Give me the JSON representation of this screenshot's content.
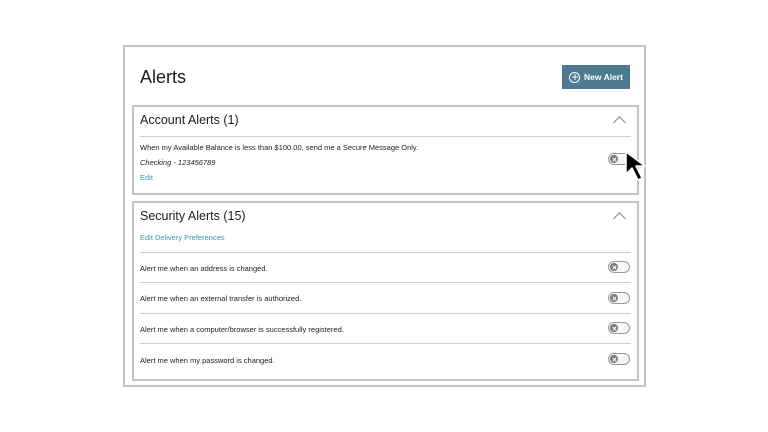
{
  "page": {
    "title": "Alerts",
    "new_alert_label": "New Alert"
  },
  "account_alerts": {
    "title": "Account Alerts (1)",
    "alert": {
      "message": "When my Available Balance is less than $100.00, send me a Secure Message Only.",
      "account": "Checking - 123456789",
      "edit_label": "Edit",
      "enabled": false
    }
  },
  "security_alerts": {
    "title": "Security Alerts (15)",
    "edit_delivery_label": "Edit Delivery Preferences",
    "items": [
      {
        "label": "Alert me when an address is changed.",
        "enabled": false
      },
      {
        "label": "Alert me when an external transfer is authorized.",
        "enabled": false
      },
      {
        "label": "Alert me when a computer/browser is successfully registered.",
        "enabled": false
      },
      {
        "label": "Alert me when my password is changed.",
        "enabled": false
      }
    ]
  },
  "colors": {
    "primary_button": "#4d7a91",
    "link": "#3a96b0",
    "border": "#c4c4c4"
  },
  "icons": [
    "plus-circle-icon",
    "chevron-up-icon",
    "toggle-off-icon",
    "mouse-pointer-icon"
  ]
}
